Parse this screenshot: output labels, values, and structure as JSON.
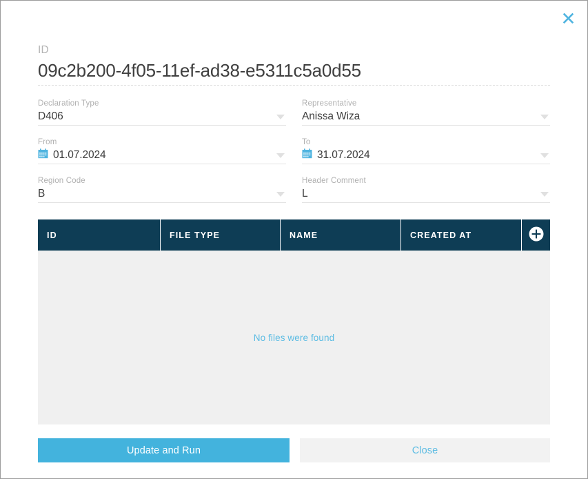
{
  "dialog": {
    "close_icon": "close-icon",
    "id_field": {
      "label": "ID",
      "value": "09c2b200-4f05-11ef-ad38-e5311c5a0d55"
    },
    "fields": [
      {
        "name": "declaration-type",
        "label": "Declaration Type",
        "value": "D406",
        "icon": "",
        "caret": "chevron-down-icon"
      },
      {
        "name": "representative",
        "label": "Representative",
        "value": "Anissa Wiza",
        "icon": "",
        "caret": "chevron-down-icon"
      },
      {
        "name": "from-date",
        "label": "From",
        "value": "01.07.2024",
        "icon": "calendar-icon",
        "caret": "chevron-down-icon"
      },
      {
        "name": "to-date",
        "label": "To",
        "value": "31.07.2024",
        "icon": "calendar-icon",
        "caret": "chevron-down-icon"
      },
      {
        "name": "region-code",
        "label": "Region Code",
        "value": "B",
        "icon": "",
        "caret": "chevron-down-icon"
      },
      {
        "name": "header-comment",
        "label": "Header Comment",
        "value": "L",
        "icon": "",
        "caret": "chevron-down-icon"
      }
    ],
    "table": {
      "columns": [
        "ID",
        "FILE TYPE",
        "NAME",
        "CREATED AT"
      ],
      "add_icon": "plus-circle-icon",
      "rows": [],
      "empty_message": "No files were found"
    },
    "footer": {
      "primary_label": "Update and Run",
      "secondary_label": "Close"
    },
    "colors": {
      "accent_blue": "#43b3dd",
      "light_blue_text": "#5cbce3",
      "table_header": "#0e3d55",
      "table_body": "#f0f0f0",
      "secondary_button_bg": "#f2f2f2"
    }
  }
}
